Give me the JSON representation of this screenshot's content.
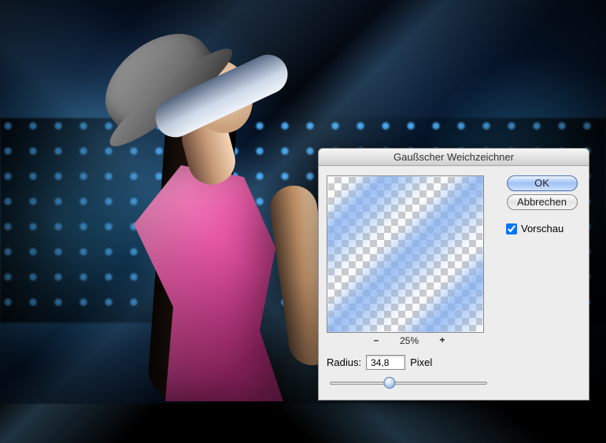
{
  "dialog": {
    "title": "Gaußscher Weichzeichner",
    "ok_label": "OK",
    "cancel_label": "Abbrechen",
    "preview_checkbox_label": "Vorschau",
    "preview_checked": true,
    "zoom": {
      "minus": "–",
      "plus": "+",
      "level": "25%"
    },
    "radius_label": "Radius:",
    "radius_value": "34,8",
    "radius_unit": "Pixel"
  }
}
